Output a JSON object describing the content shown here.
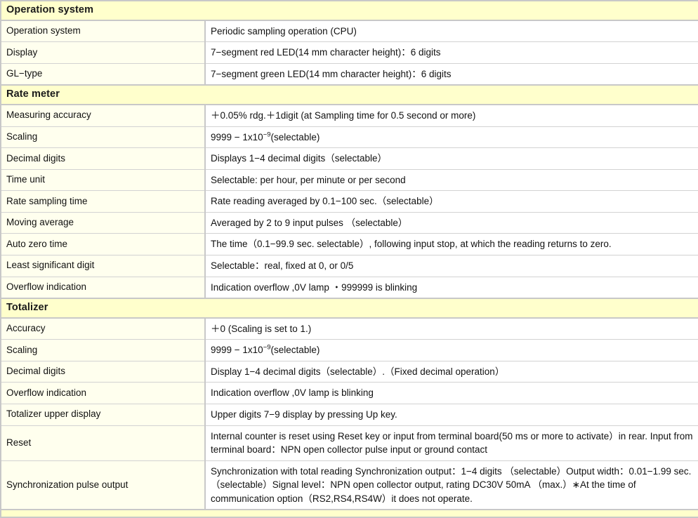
{
  "document": {
    "type": "product-specification-table",
    "colors": {
      "section_header_bg": "#ffffcc",
      "label_cell_bg": "#ffffee",
      "value_cell_bg": "#ffffff",
      "outer_border": "#c8c8c8",
      "inner_border": "#d2d2d2",
      "text": "#111111"
    }
  },
  "sections": [
    {
      "title": "Operation system",
      "rows": [
        {
          "label": "Operation system",
          "value": "Periodic sampling operation (CPU)"
        },
        {
          "label": "Display",
          "value": "7−segment red LED(14 mm character height)：6 digits"
        },
        {
          "label": "GL−type",
          "value": "7−segment green LED(14 mm character height)：6 digits"
        }
      ]
    },
    {
      "title": "Rate meter",
      "rows": [
        {
          "label": "Measuring accuracy",
          "value": "＋0.05% rdg.＋1digit (at Sampling time for 0.5 second or more)"
        },
        {
          "label": "Scaling",
          "value_prefix": "9999 − 1x10",
          "value_exponent": "−9",
          "value_suffix": "(selectable)"
        },
        {
          "label": "Decimal digits",
          "value": "Displays 1−4 decimal digits（selectable）"
        },
        {
          "label": "Time unit",
          "value": "Selectable: per hour, per minute or per second"
        },
        {
          "label": "Rate sampling time",
          "value": "Rate reading averaged by 0.1−100 sec.（selectable）"
        },
        {
          "label": "Moving average",
          "value": "Averaged by 2 to 9 input pulses （selectable）"
        },
        {
          "label": "Auto zero time",
          "value": "The time（0.1−99.9 sec. selectable）, following input stop, at which the reading returns to zero."
        },
        {
          "label": "Least significant digit",
          "value": "Selectable：real, fixed at 0, or 0/5"
        },
        {
          "label": "Overflow indication",
          "value": "Indication overflow ,0V lamp ・999999 is blinking"
        }
      ]
    },
    {
      "title": "Totalizer",
      "rows": [
        {
          "label": "Accuracy",
          "value": "＋0 (Scaling is set to 1.)"
        },
        {
          "label": "Scaling",
          "value_prefix": "9999 − 1x10",
          "value_exponent": "−9",
          "value_suffix": "(selectable)"
        },
        {
          "label": "Decimal digits",
          "value": "Display 1−4 decimal digits（selectable）.（Fixed decimal operation）"
        },
        {
          "label": "Overflow indication",
          "value": "Indication overflow ,0V lamp is blinking"
        },
        {
          "label": "Totalizer upper display",
          "value": "Upper digits 7−9 display by pressing Up key."
        },
        {
          "label": "Reset",
          "value": "Internal counter is reset using Reset key or input from terminal board(50 ms or more to activate）in rear. Input from terminal board：NPN open collector pulse input or ground contact"
        },
        {
          "label": "Synchronization pulse output",
          "value": "Synchronization with total reading Synchronization output：1−4 digits （selectable）Output width：0.01−1.99 sec.（selectable）Signal level：NPN open collector output, rating DC30V 50mA （max.）∗At the time of communication option（RS2,RS4,RS4W）it does not operate."
        }
      ]
    },
    {
      "title": "",
      "partial": true,
      "rows": []
    }
  ]
}
